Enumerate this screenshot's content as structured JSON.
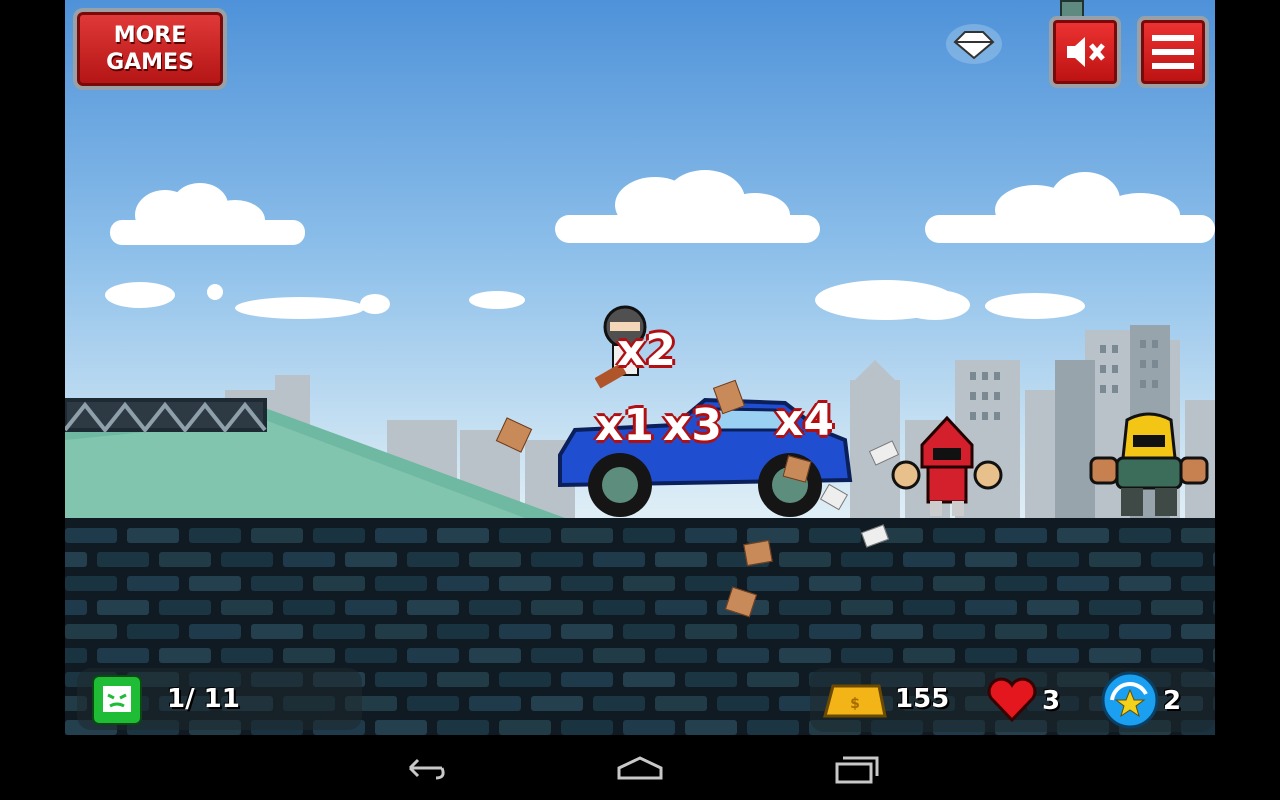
{
  "header": {
    "more_games_line1": "MORE",
    "more_games_line2": "GAMES"
  },
  "combos": [
    "x2",
    "x1",
    "x3",
    "x4"
  ],
  "hud": {
    "enemies_killed": "1/ 11",
    "gold": "155",
    "lives": "3",
    "special": "2"
  },
  "colors": {
    "button_red": "#d22222",
    "sky_top": "#4f92d9",
    "wall": "#0f1a22",
    "counter_green": "#1fbd36"
  },
  "icons": {
    "sound": "mute-icon",
    "menu": "hamburger-menu-icon",
    "diamond": "diamond-icon",
    "counter": "angry-face-icon",
    "gold": "gold-bar-icon",
    "lives": "heart-icon",
    "special": "star-orb-icon"
  }
}
